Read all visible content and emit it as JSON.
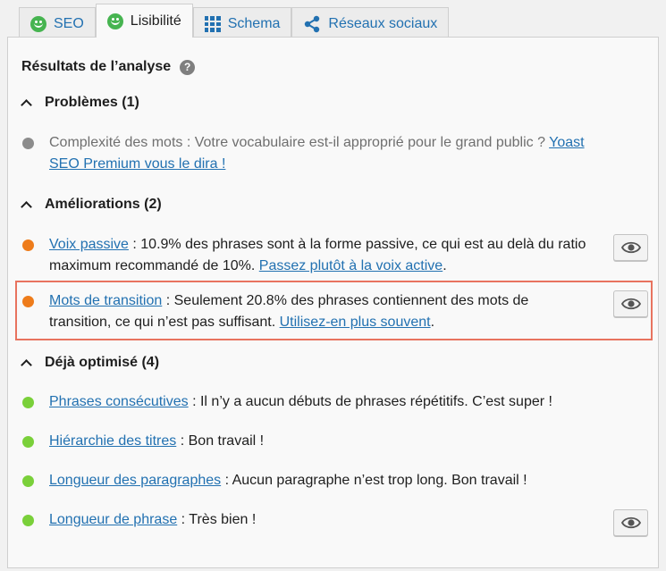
{
  "tabs": [
    {
      "label": "SEO",
      "icon": "smiley-icon",
      "active": false
    },
    {
      "label": "Lisibilité",
      "icon": "smiley-icon",
      "active": true
    },
    {
      "label": "Schema",
      "icon": "grid-icon",
      "active": false
    },
    {
      "label": "Réseaux sociaux",
      "icon": "share-icon",
      "active": false
    }
  ],
  "colors": {
    "good": "#7ad03a",
    "ok": "#ee7c1b",
    "grey": "#8c8c8c",
    "link": "#2271b1",
    "highlight": "#e8735f"
  },
  "panel": {
    "title": "Résultats de l’analyse",
    "help": "?",
    "groups": [
      {
        "heading": "Problèmes (1)",
        "items": [
          {
            "text": "Complexité des mots : Votre vocabulaire est-il approprié pour le grand public ? ",
            "link": "Yoast SEO Premium vous le dira !",
            "status": "grey"
          }
        ]
      },
      {
        "heading": "Améliorations (2)",
        "items": [
          {
            "link1": "Voix passive",
            "text": " : 10.9% des phrases sont à la forme passive, ce qui est au delà du ratio maximum recommandé de 10%. ",
            "link2": "Passez plutôt à la voix active",
            "end": ".",
            "status": "ok"
          },
          {
            "link1": "Mots de transition",
            "text": " : Seulement 20.8% des phrases contiennent des mots de transition, ce qui n’est pas suffisant. ",
            "link2": "Utilisez-en plus souvent",
            "end": ".",
            "status": "ok"
          }
        ]
      },
      {
        "heading": "Déjà optimisé (4)",
        "items": [
          {
            "link1": "Phrases consécutives",
            "text": " : Il n’y a aucun débuts de phrases répétitifs. C’est super !",
            "status": "good"
          },
          {
            "link1": "Hiérarchie des titres",
            "text": " : Bon travail !",
            "status": "good"
          },
          {
            "link1": "Longueur des paragraphes",
            "text": " : Aucun paragraphe n’est trop long. Bon travail !",
            "status": "good"
          },
          {
            "link1": "Longueur de phrase",
            "text": " : Très bien !",
            "status": "good"
          }
        ]
      }
    ]
  }
}
